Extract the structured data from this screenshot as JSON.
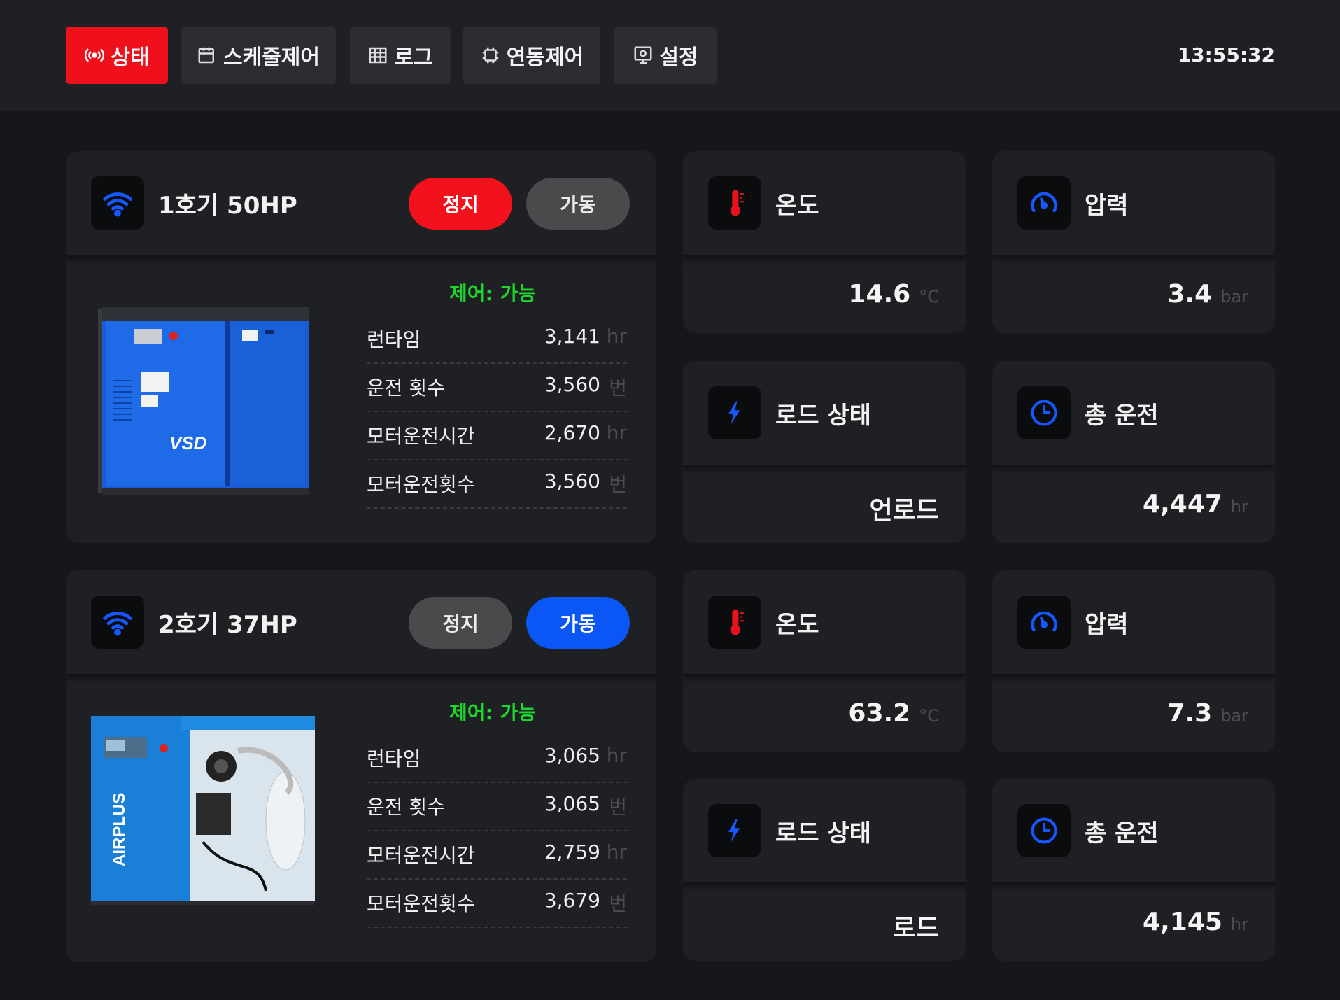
{
  "nav": {
    "tabs": [
      {
        "label": "상태",
        "icon": "broadcast-icon"
      },
      {
        "label": "스케줄제어",
        "icon": "calendar-icon"
      },
      {
        "label": "로그",
        "icon": "table-icon"
      },
      {
        "label": "연동제어",
        "icon": "chip-icon"
      },
      {
        "label": "설정",
        "icon": "settings-icon"
      }
    ],
    "clock": "13:55:32"
  },
  "colors": {
    "accent_red": "#f0101c",
    "accent_blue": "#0b57f5",
    "ok_green": "#1cd62c"
  },
  "machines": [
    {
      "title": "1호기 50HP",
      "stop_label": "정지",
      "run_label": "가동",
      "active_state": "정지",
      "control": "제어: 가능",
      "image_text": "VSD",
      "stats": [
        {
          "label": "런타임",
          "value": "3,141",
          "unit": "hr"
        },
        {
          "label": "운전 횟수",
          "value": "3,560",
          "unit": "번"
        },
        {
          "label": "모터운전시간",
          "value": "2,670",
          "unit": "hr"
        },
        {
          "label": "모터운전횟수",
          "value": "3,560",
          "unit": "번"
        }
      ],
      "temperature": {
        "label": "온도",
        "value": "14.6",
        "unit": "°C"
      },
      "pressure": {
        "label": "압력",
        "value": "3.4",
        "unit": "bar"
      },
      "load": {
        "label": "로드 상태",
        "value": "언로드"
      },
      "total": {
        "label": "총 운전",
        "value": "4,447",
        "unit": "hr"
      }
    },
    {
      "title": "2호기 37HP",
      "stop_label": "정지",
      "run_label": "가동",
      "active_state": "가동",
      "control": "제어: 가능",
      "image_text": "AIRPLUS",
      "stats": [
        {
          "label": "런타임",
          "value": "3,065",
          "unit": "hr"
        },
        {
          "label": "운전 횟수",
          "value": "3,065",
          "unit": "번"
        },
        {
          "label": "모터운전시간",
          "value": "2,759",
          "unit": "hr"
        },
        {
          "label": "모터운전횟수",
          "value": "3,679",
          "unit": "번"
        }
      ],
      "temperature": {
        "label": "온도",
        "value": "63.2",
        "unit": "°C"
      },
      "pressure": {
        "label": "압력",
        "value": "7.3",
        "unit": "bar"
      },
      "load": {
        "label": "로드 상태",
        "value": "로드"
      },
      "total": {
        "label": "총 운전",
        "value": "4,145",
        "unit": "hr"
      }
    }
  ]
}
